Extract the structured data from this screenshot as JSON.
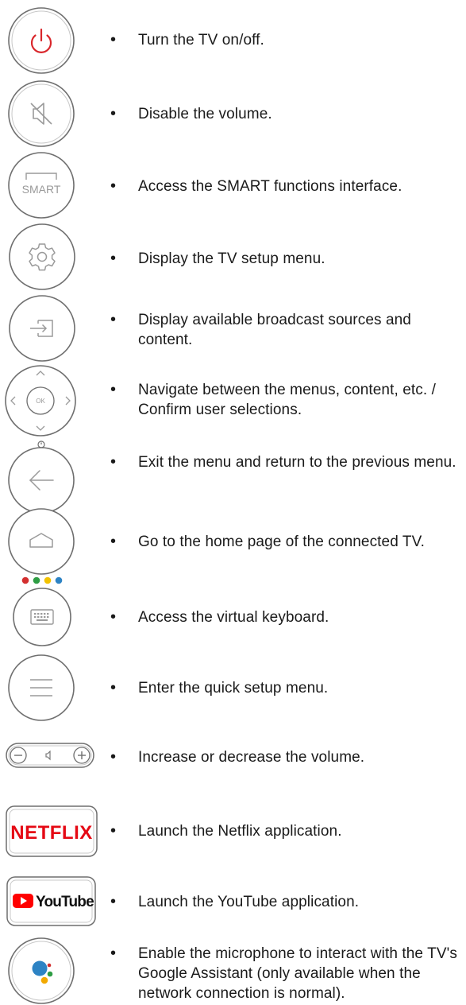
{
  "items": [
    {
      "icon": "power-icon",
      "text": "Turn the TV on/off."
    },
    {
      "icon": "mute-icon",
      "text": "Disable the volume."
    },
    {
      "icon": "smart-button",
      "label": "SMART",
      "text": "Access the SMART functions interface."
    },
    {
      "icon": "gear-icon",
      "text": "Display the TV setup menu."
    },
    {
      "icon": "input-source-icon",
      "text": "Display available broadcast sources and content."
    },
    {
      "icon": "navigation-pad",
      "label": "OK",
      "text": "Navigate between the menus, content, etc. / Confirm user selections."
    },
    {
      "icon": "back-arrow-icon",
      "text": "Exit the menu and return to the previous menu."
    },
    {
      "icon": "home-icon",
      "text": "Go to the home page of the connected TV."
    },
    {
      "icon": "keyboard-icon",
      "text": "Access the virtual keyboard."
    },
    {
      "icon": "hamburger-menu-icon",
      "text": "Enter the quick setup menu."
    },
    {
      "icon": "volume-rocker",
      "text": "Increase or decrease the volume."
    },
    {
      "icon": "netflix-button",
      "label": "NETFLIX",
      "text": "Launch the Netflix application."
    },
    {
      "icon": "youtube-button",
      "label": "YouTube",
      "text": "Launch the YouTube application."
    },
    {
      "icon": "google-assistant-icon",
      "text": "Enable the microphone to interact with the TV's Google Assistant (only available when the network connection is normal)."
    }
  ],
  "bullet": "•",
  "colors": {
    "power_red": "#d9262b",
    "outline_gray": "#6f6f6f",
    "icon_gray": "#9a9a9a",
    "netflix_red": "#e50914",
    "youtube_red": "#ff0000",
    "dot_red": "#d32f2f",
    "dot_green": "#2e9d44",
    "dot_yellow": "#f2c200",
    "dot_blue": "#2d83c4"
  }
}
